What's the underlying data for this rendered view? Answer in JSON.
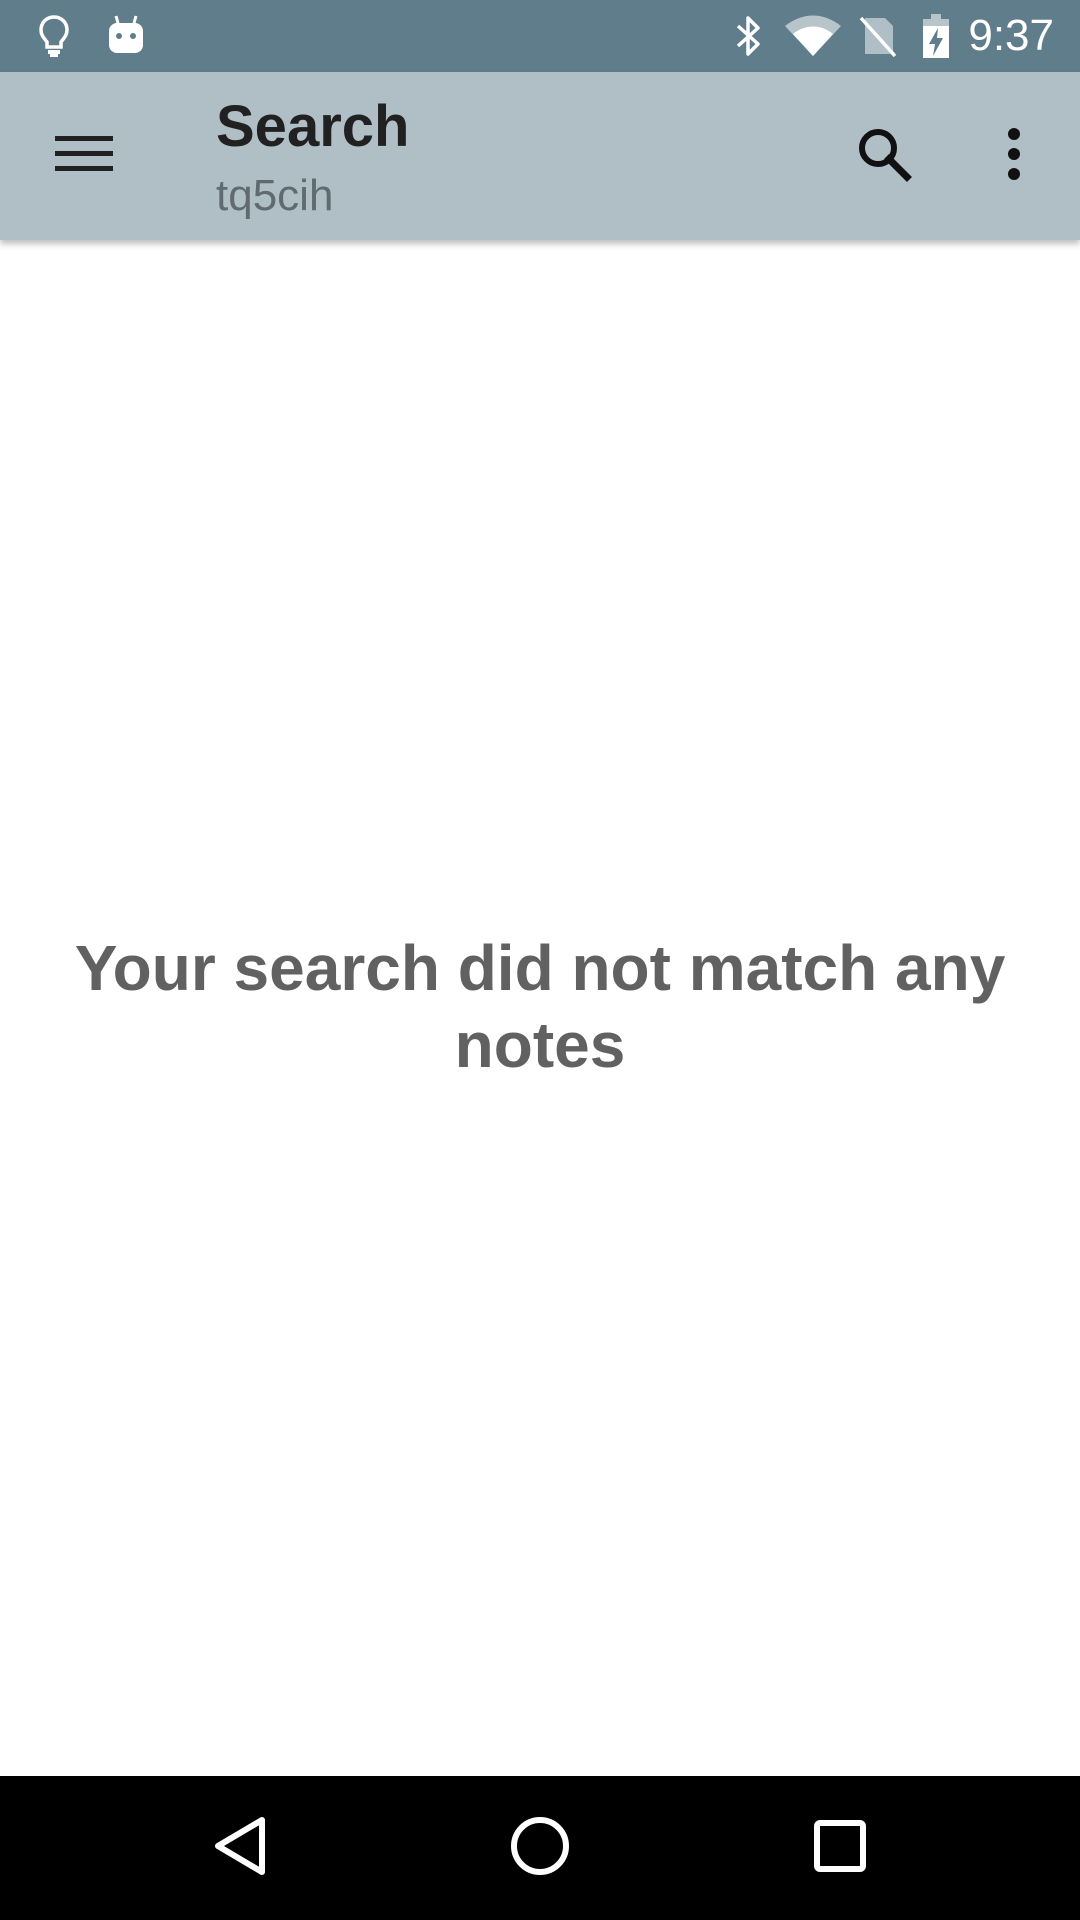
{
  "status_bar": {
    "time": "9:37",
    "left_icons": [
      "lightbulb-icon",
      "android-icon"
    ],
    "right_icons": [
      "bluetooth-icon",
      "wifi-icon",
      "no-sim-icon",
      "battery-charging-icon"
    ],
    "background_color": "#607d8b"
  },
  "app_bar": {
    "title": "Search",
    "subtitle": "tq5cih",
    "background_color": "#b0bec5",
    "icons": [
      "menu-icon",
      "search-icon",
      "more-vert-icon"
    ]
  },
  "content": {
    "empty_message": "Your search did not match any notes"
  },
  "nav_bar": {
    "icons": [
      "back-icon",
      "home-icon",
      "recents-icon"
    ]
  }
}
